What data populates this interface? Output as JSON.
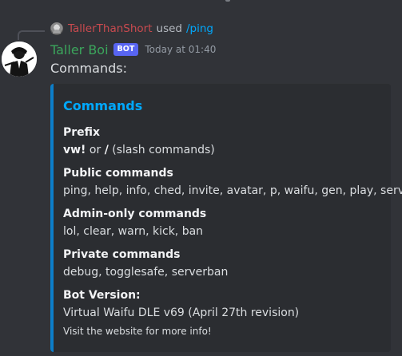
{
  "reply": {
    "username": "TallerThanShort",
    "used_text": "used",
    "command": "/ping"
  },
  "message": {
    "author": "Taller Boi",
    "bot_tag": "BOT",
    "timestamp": "Today at 01:40",
    "content": "Commands:"
  },
  "embed": {
    "accent_color": "#0c7ec9",
    "title": "Commands",
    "fields": [
      {
        "name": "Prefix",
        "value_parts": {
          "prefix": "vw!",
          "or": " or ",
          "slash": "/",
          "suffix": " (slash commands)"
        }
      },
      {
        "name": "Public commands",
        "value": "ping, help, info, ched, invite, avatar, p, waifu, gen, play, server"
      },
      {
        "name": "Admin-only commands",
        "value": "lol, clear, warn, kick, ban"
      },
      {
        "name": "Private commands",
        "value": "debug, togglesafe, serverban"
      },
      {
        "name": "Bot Version:",
        "value": "Virtual Waifu DLE v69 (April 27th revision)"
      }
    ],
    "footer": "Visit the website for more info!"
  },
  "colors": {
    "background": "#313338",
    "username": "#3ba55c",
    "reply_username": "#c94a4f",
    "link": "#00a8fc",
    "bot_tag": "#5865f2"
  },
  "icons": {
    "reply_avatar": "reply-avatar-icon",
    "author_avatar": "avatar-icon"
  }
}
